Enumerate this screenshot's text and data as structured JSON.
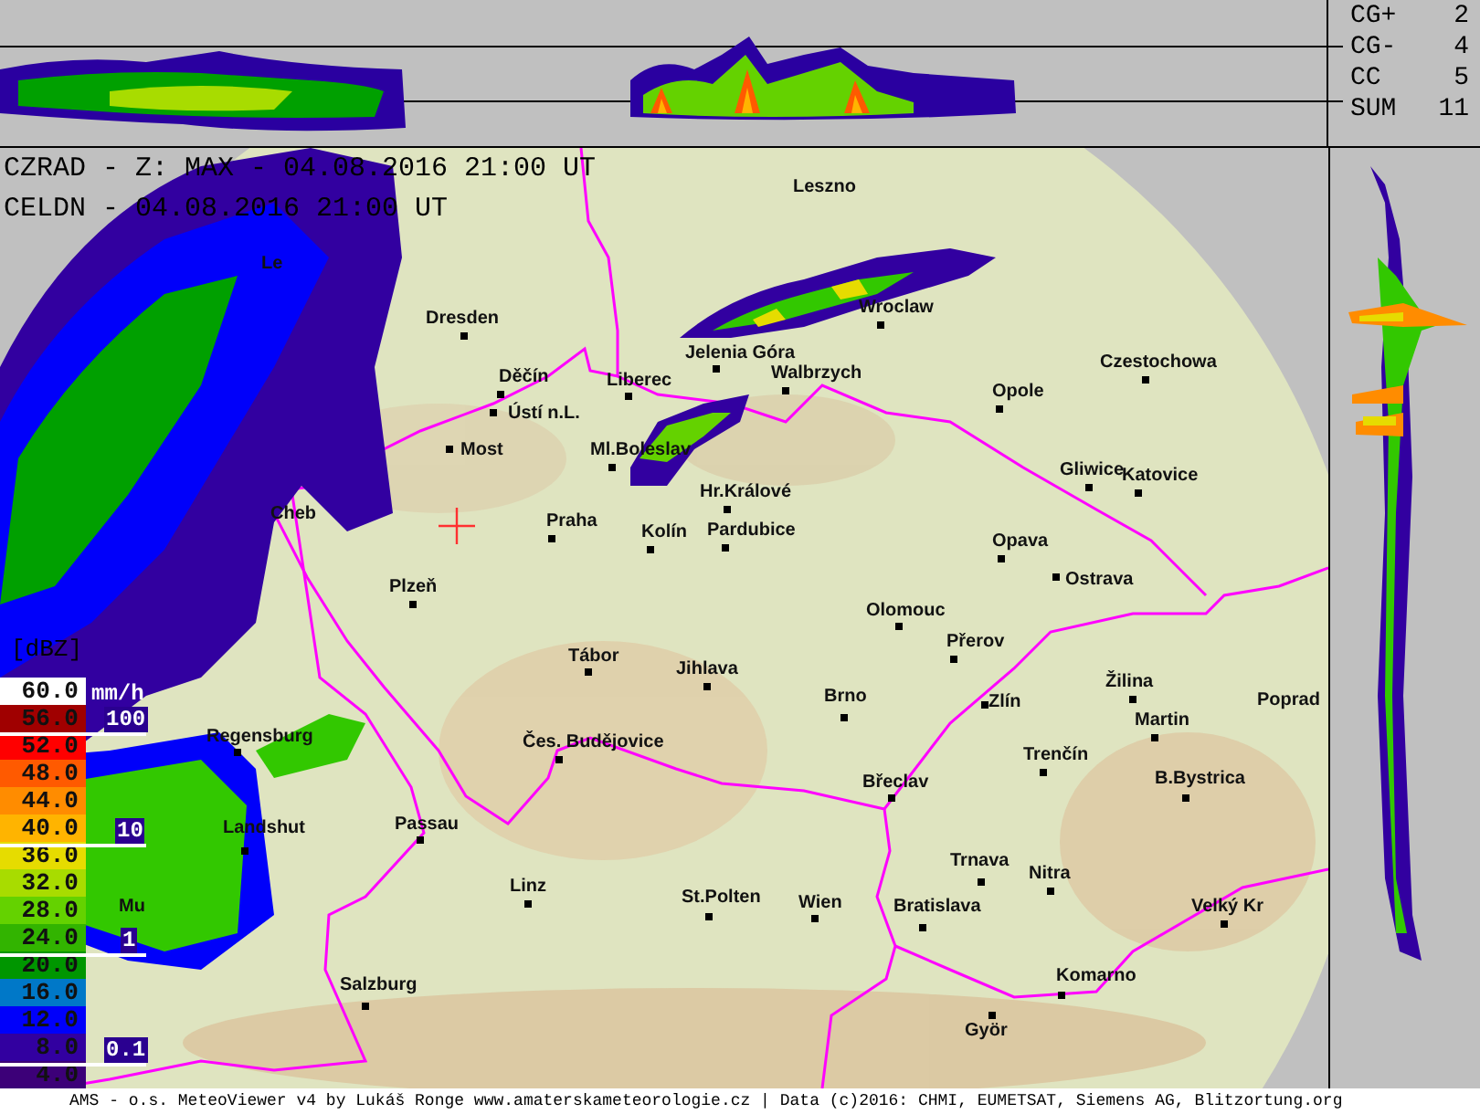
{
  "titles": [
    "CZRAD - Z: MAX - 04.08.2016 21:00 UT",
    "CELDN - 04.08.2016 21:00 UT"
  ],
  "lightning_stats": [
    {
      "label": "CG+",
      "value": "2"
    },
    {
      "label": "CG-",
      "value": "4"
    },
    {
      "label": "CC",
      "value": "5"
    },
    {
      "label": "SUM",
      "value": "11"
    }
  ],
  "legend": {
    "unit": "[dBZ]",
    "rate_unit": "mm/h",
    "steps": [
      {
        "label": "60.0",
        "color": "#ffffff"
      },
      {
        "label": "56.0",
        "color": "#a00000"
      },
      {
        "label": "52.0",
        "color": "#ff0000"
      },
      {
        "label": "48.0",
        "color": "#ff5a00"
      },
      {
        "label": "44.0",
        "color": "#ff8c00"
      },
      {
        "label": "40.0",
        "color": "#ffb400"
      },
      {
        "label": "36.0",
        "color": "#e6dc00"
      },
      {
        "label": "32.0",
        "color": "#a8dc00"
      },
      {
        "label": "28.0",
        "color": "#64d200"
      },
      {
        "label": "24.0",
        "color": "#32b400"
      },
      {
        "label": "20.0",
        "color": "#009600"
      },
      {
        "label": "16.0",
        "color": "#0078c8"
      },
      {
        "label": "12.0",
        "color": "#0000fa"
      },
      {
        "label": "8.0",
        "color": "#3200a0"
      },
      {
        "label": "4.0",
        "color": "#3c0078"
      }
    ],
    "rate_marks": [
      "100",
      "10",
      "1",
      "0.1"
    ]
  },
  "cities": [
    {
      "name": "Leszno"
    },
    {
      "name": "Wroclaw"
    },
    {
      "name": "Dresden"
    },
    {
      "name": "Jelenia Góra"
    },
    {
      "name": "Děčín"
    },
    {
      "name": "Liberec"
    },
    {
      "name": "Walbrzych"
    },
    {
      "name": "Ústí n.L."
    },
    {
      "name": "Opole"
    },
    {
      "name": "Czestochowa"
    },
    {
      "name": "Most"
    },
    {
      "name": "Ml.Boleslav"
    },
    {
      "name": "Hr.Králové"
    },
    {
      "name": "Gliwice"
    },
    {
      "name": "Katovice"
    },
    {
      "name": "Praha"
    },
    {
      "name": "Kolín"
    },
    {
      "name": "Pardubice"
    },
    {
      "name": "Cheb"
    },
    {
      "name": "Opava"
    },
    {
      "name": "Ostrava"
    },
    {
      "name": "Plzeň"
    },
    {
      "name": "Olomouc"
    },
    {
      "name": "Přerov"
    },
    {
      "name": "Tábor"
    },
    {
      "name": "Jihlava"
    },
    {
      "name": "Brno"
    },
    {
      "name": "Zlín"
    },
    {
      "name": "Žilina"
    },
    {
      "name": "Poprad"
    },
    {
      "name": "Martin"
    },
    {
      "name": "Regensburg"
    },
    {
      "name": "Čes. Budějovice"
    },
    {
      "name": "Trenčín"
    },
    {
      "name": "B.Bystrica"
    },
    {
      "name": "Břeclav"
    },
    {
      "name": "Passau"
    },
    {
      "name": "Landshut"
    },
    {
      "name": "Trnava"
    },
    {
      "name": "Nitra"
    },
    {
      "name": "Linz"
    },
    {
      "name": "St.Polten"
    },
    {
      "name": "Wien"
    },
    {
      "name": "Bratislava"
    },
    {
      "name": "Velký Kr"
    },
    {
      "name": "Komarno"
    },
    {
      "name": "Salzburg"
    },
    {
      "name": "Györ"
    },
    {
      "name": "Mu"
    },
    {
      "name": "Le"
    }
  ],
  "footer": "AMS - o.s. MeteoViewer v4 by Lukáš Ronge www.amaterskameteorologie.cz | Data (c)2016: CHMI, EUMETSAT, Siemens AG, Blitzortung.org"
}
